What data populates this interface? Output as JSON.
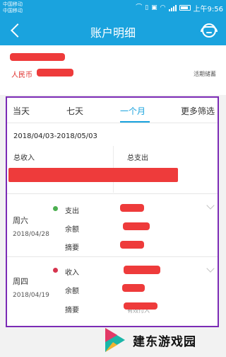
{
  "status_bar": {
    "carrier_1": "中国移动",
    "carrier_2": "中国移动",
    "icons": [
      "headset-icon",
      "sim-icon",
      "hd-icon",
      "wifi-icon",
      "signal-icon",
      "battery-icon"
    ],
    "time": "上午9:56"
  },
  "header": {
    "title": "账户明细",
    "background_color": "#1aa3de"
  },
  "account": {
    "currency": "人民币",
    "deposit_type": "活期储蓄"
  },
  "filters": {
    "tabs": [
      {
        "label": "当天"
      },
      {
        "label": "七天"
      },
      {
        "label": "一个月",
        "active": true
      },
      {
        "label": "更多筛选"
      }
    ],
    "accent_color": "#1aa3de"
  },
  "period": {
    "range": "2018/04/03-2018/05/03",
    "total_income_label": "总收入",
    "total_expense_label": "总支出"
  },
  "records": [
    {
      "weekday": "周六",
      "date": "2018/04/28",
      "type": "支出",
      "type_color": "#4caf50",
      "balance_label": "余额",
      "memo_label": "摘要"
    },
    {
      "weekday": "周四",
      "date": "2018/04/19",
      "type": "收入",
      "type_color": "#d6344e",
      "balance_label": "余额",
      "memo_label": "摘要",
      "counterparty": "有效付入"
    }
  ],
  "highlight_color": "#7b2bb5",
  "watermark": {
    "text": "建东游戏园"
  }
}
